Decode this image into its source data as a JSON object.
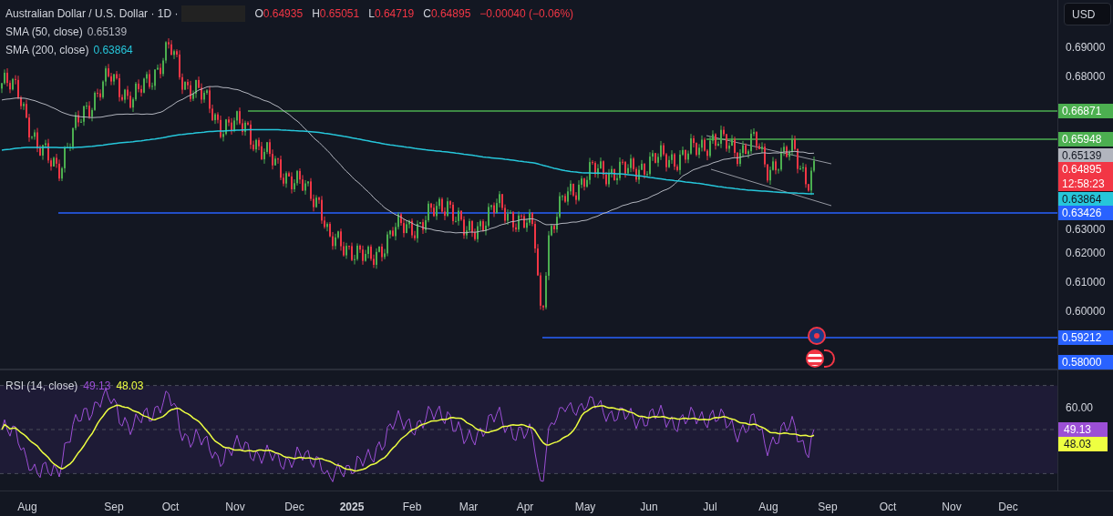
{
  "header": {
    "symbol": "Australian Dollar / U.S. Dollar · 1D ·",
    "ohlc": [
      {
        "key": "O",
        "value": "0.64935"
      },
      {
        "key": "H",
        "value": "0.65051"
      },
      {
        "key": "L",
        "value": "0.64719"
      },
      {
        "key": "C",
        "value": "0.64895"
      }
    ],
    "change": "−0.00040 (−0.06%)"
  },
  "indicators": [
    {
      "label": "SMA (50, close)",
      "value": "0.65139",
      "color": "#b2b5be"
    },
    {
      "label": "SMA (200, close)",
      "value": "0.63864",
      "color": "#26c6da"
    }
  ],
  "currency_button": "USD",
  "price_axis": [
    "0.69000",
    "0.68000",
    "0.63000",
    "0.62000",
    "0.61000",
    "0.60000"
  ],
  "price_labels": [
    {
      "value": "0.66871",
      "color": "#4caf50"
    },
    {
      "value": "0.65948",
      "color": "#4caf50"
    },
    {
      "value": "0.65139",
      "color": "#b2b5be"
    },
    {
      "value": "0.64895",
      "time": "12:58:23",
      "color": "#f23645"
    },
    {
      "value": "0.63864",
      "color": "#26c6da"
    },
    {
      "value": "0.63426",
      "color": "#2962ff"
    },
    {
      "value": "0.59212",
      "color": "#2962ff"
    },
    {
      "value": "0.58000",
      "color": "#2962ff"
    }
  ],
  "rsi": {
    "label": "RSI (14, close)",
    "value": "49.13",
    "ma_value": "48.03",
    "axis_tick": "60.00",
    "labels": [
      {
        "value": "49.13",
        "color": "#9c4fd6"
      },
      {
        "value": "48.03",
        "color": "#eeff41"
      }
    ]
  },
  "time_axis": [
    {
      "label": "Aug",
      "kind": "month"
    },
    {
      "label": "Sep",
      "kind": "month"
    },
    {
      "label": "Oct",
      "kind": "month"
    },
    {
      "label": "Nov",
      "kind": "month"
    },
    {
      "label": "Dec",
      "kind": "month"
    },
    {
      "label": "2025",
      "kind": "year"
    },
    {
      "label": "Feb",
      "kind": "month"
    },
    {
      "label": "Mar",
      "kind": "month"
    },
    {
      "label": "Apr",
      "kind": "month"
    },
    {
      "label": "May",
      "kind": "month"
    },
    {
      "label": "Jun",
      "kind": "month"
    },
    {
      "label": "Jul",
      "kind": "month"
    },
    {
      "label": "Aug",
      "kind": "month"
    },
    {
      "label": "Sep",
      "kind": "month"
    },
    {
      "label": "Oct",
      "kind": "month"
    },
    {
      "label": "Nov",
      "kind": "month"
    },
    {
      "label": "Dec",
      "kind": "month"
    }
  ]
}
